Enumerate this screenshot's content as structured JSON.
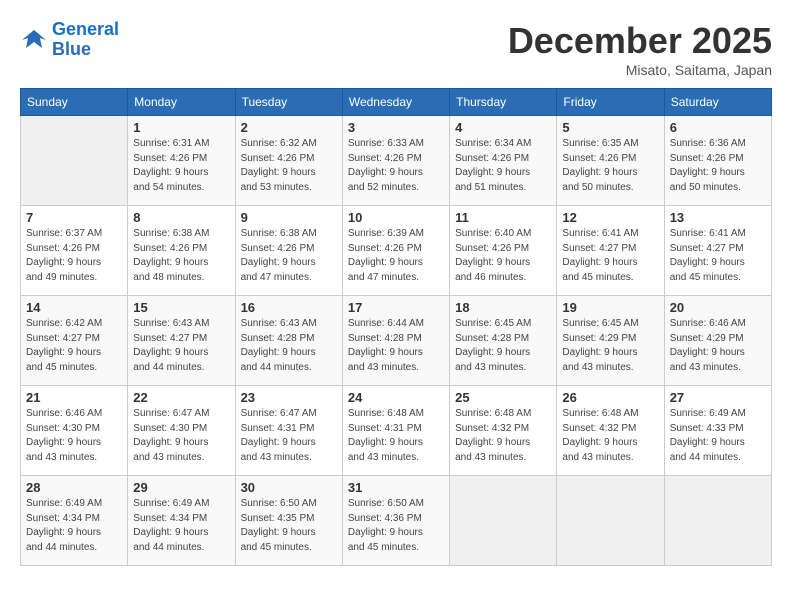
{
  "logo": {
    "line1": "General",
    "line2": "Blue"
  },
  "title": "December 2025",
  "location": "Misato, Saitama, Japan",
  "days_of_week": [
    "Sunday",
    "Monday",
    "Tuesday",
    "Wednesday",
    "Thursday",
    "Friday",
    "Saturday"
  ],
  "weeks": [
    [
      {
        "day": "",
        "info": ""
      },
      {
        "day": "1",
        "info": "Sunrise: 6:31 AM\nSunset: 4:26 PM\nDaylight: 9 hours\nand 54 minutes."
      },
      {
        "day": "2",
        "info": "Sunrise: 6:32 AM\nSunset: 4:26 PM\nDaylight: 9 hours\nand 53 minutes."
      },
      {
        "day": "3",
        "info": "Sunrise: 6:33 AM\nSunset: 4:26 PM\nDaylight: 9 hours\nand 52 minutes."
      },
      {
        "day": "4",
        "info": "Sunrise: 6:34 AM\nSunset: 4:26 PM\nDaylight: 9 hours\nand 51 minutes."
      },
      {
        "day": "5",
        "info": "Sunrise: 6:35 AM\nSunset: 4:26 PM\nDaylight: 9 hours\nand 50 minutes."
      },
      {
        "day": "6",
        "info": "Sunrise: 6:36 AM\nSunset: 4:26 PM\nDaylight: 9 hours\nand 50 minutes."
      }
    ],
    [
      {
        "day": "7",
        "info": "Sunrise: 6:37 AM\nSunset: 4:26 PM\nDaylight: 9 hours\nand 49 minutes."
      },
      {
        "day": "8",
        "info": "Sunrise: 6:38 AM\nSunset: 4:26 PM\nDaylight: 9 hours\nand 48 minutes."
      },
      {
        "day": "9",
        "info": "Sunrise: 6:38 AM\nSunset: 4:26 PM\nDaylight: 9 hours\nand 47 minutes."
      },
      {
        "day": "10",
        "info": "Sunrise: 6:39 AM\nSunset: 4:26 PM\nDaylight: 9 hours\nand 47 minutes."
      },
      {
        "day": "11",
        "info": "Sunrise: 6:40 AM\nSunset: 4:26 PM\nDaylight: 9 hours\nand 46 minutes."
      },
      {
        "day": "12",
        "info": "Sunrise: 6:41 AM\nSunset: 4:27 PM\nDaylight: 9 hours\nand 45 minutes."
      },
      {
        "day": "13",
        "info": "Sunrise: 6:41 AM\nSunset: 4:27 PM\nDaylight: 9 hours\nand 45 minutes."
      }
    ],
    [
      {
        "day": "14",
        "info": "Sunrise: 6:42 AM\nSunset: 4:27 PM\nDaylight: 9 hours\nand 45 minutes."
      },
      {
        "day": "15",
        "info": "Sunrise: 6:43 AM\nSunset: 4:27 PM\nDaylight: 9 hours\nand 44 minutes."
      },
      {
        "day": "16",
        "info": "Sunrise: 6:43 AM\nSunset: 4:28 PM\nDaylight: 9 hours\nand 44 minutes."
      },
      {
        "day": "17",
        "info": "Sunrise: 6:44 AM\nSunset: 4:28 PM\nDaylight: 9 hours\nand 43 minutes."
      },
      {
        "day": "18",
        "info": "Sunrise: 6:45 AM\nSunset: 4:28 PM\nDaylight: 9 hours\nand 43 minutes."
      },
      {
        "day": "19",
        "info": "Sunrise: 6:45 AM\nSunset: 4:29 PM\nDaylight: 9 hours\nand 43 minutes."
      },
      {
        "day": "20",
        "info": "Sunrise: 6:46 AM\nSunset: 4:29 PM\nDaylight: 9 hours\nand 43 minutes."
      }
    ],
    [
      {
        "day": "21",
        "info": "Sunrise: 6:46 AM\nSunset: 4:30 PM\nDaylight: 9 hours\nand 43 minutes."
      },
      {
        "day": "22",
        "info": "Sunrise: 6:47 AM\nSunset: 4:30 PM\nDaylight: 9 hours\nand 43 minutes."
      },
      {
        "day": "23",
        "info": "Sunrise: 6:47 AM\nSunset: 4:31 PM\nDaylight: 9 hours\nand 43 minutes."
      },
      {
        "day": "24",
        "info": "Sunrise: 6:48 AM\nSunset: 4:31 PM\nDaylight: 9 hours\nand 43 minutes."
      },
      {
        "day": "25",
        "info": "Sunrise: 6:48 AM\nSunset: 4:32 PM\nDaylight: 9 hours\nand 43 minutes."
      },
      {
        "day": "26",
        "info": "Sunrise: 6:48 AM\nSunset: 4:32 PM\nDaylight: 9 hours\nand 43 minutes."
      },
      {
        "day": "27",
        "info": "Sunrise: 6:49 AM\nSunset: 4:33 PM\nDaylight: 9 hours\nand 44 minutes."
      }
    ],
    [
      {
        "day": "28",
        "info": "Sunrise: 6:49 AM\nSunset: 4:34 PM\nDaylight: 9 hours\nand 44 minutes."
      },
      {
        "day": "29",
        "info": "Sunrise: 6:49 AM\nSunset: 4:34 PM\nDaylight: 9 hours\nand 44 minutes."
      },
      {
        "day": "30",
        "info": "Sunrise: 6:50 AM\nSunset: 4:35 PM\nDaylight: 9 hours\nand 45 minutes."
      },
      {
        "day": "31",
        "info": "Sunrise: 6:50 AM\nSunset: 4:36 PM\nDaylight: 9 hours\nand 45 minutes."
      },
      {
        "day": "",
        "info": ""
      },
      {
        "day": "",
        "info": ""
      },
      {
        "day": "",
        "info": ""
      }
    ]
  ]
}
